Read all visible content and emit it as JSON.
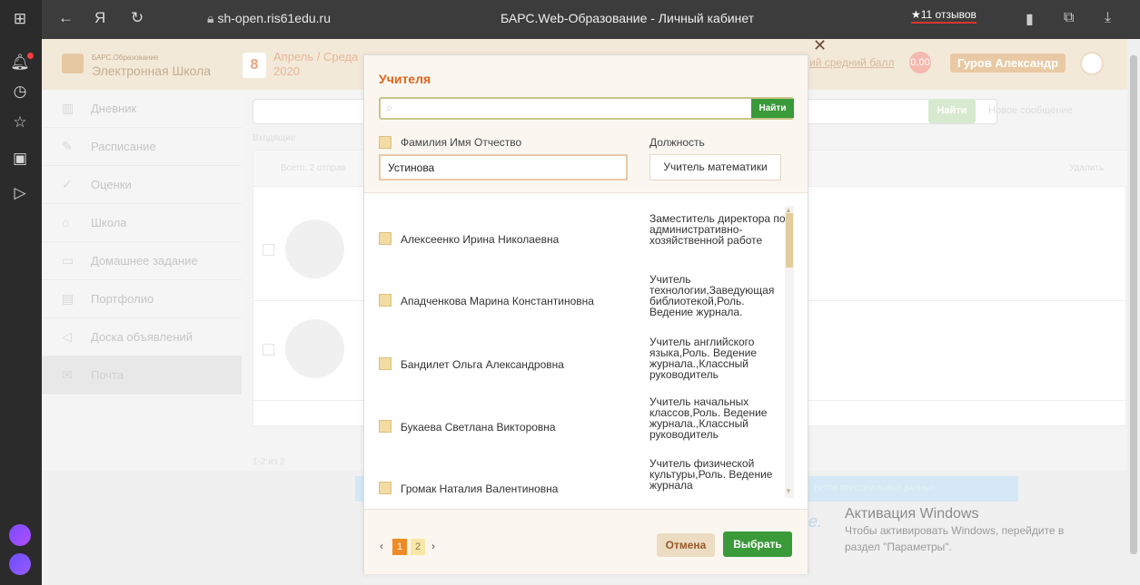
{
  "browser": {
    "url": "sh-open.ris61edu.ru",
    "page_title": "БАРС.Web-Образование - Личный кабинет",
    "reviews": "★11 отзывов"
  },
  "site": {
    "logo_small": "БАРС.Образование",
    "logo_big": "Электронная Школа",
    "date_day": "8",
    "date_text": "Апрель / Среда",
    "date_year": "2020",
    "avg_label": "ий средний балл",
    "avg_value": "0.00",
    "user_name": "Гуров Александр",
    "search_button": "Найти",
    "new_message": "Новое сообщение",
    "tabs": "Входящие",
    "total": "Всего: 2 отправ",
    "delete": "Удалить",
    "pager": "1-2 из 2",
    "banner_text": "ЕКТОВ ПЕРСОНАЛЬНЫХ ДАННЫХ",
    "nav": [
      {
        "label": "Дневник",
        "icon": "book-icon"
      },
      {
        "label": "Расписание",
        "icon": "pencil-icon"
      },
      {
        "label": "Оценки",
        "icon": "check-icon"
      },
      {
        "label": "Школа",
        "icon": "building-icon"
      },
      {
        "label": "Домашнее задание",
        "icon": "monitor-icon"
      },
      {
        "label": "Портфолио",
        "icon": "portfolio-icon"
      },
      {
        "label": "Доска объявлений",
        "icon": "megaphone-icon"
      },
      {
        "label": "Почта",
        "icon": "mail-icon"
      }
    ]
  },
  "modal": {
    "title": "Учителя",
    "search_placeholder": "",
    "search_button": "Найти",
    "fio_label": "Фамилия Имя Отчество",
    "position_label": "Должность",
    "fio_value": "Устинова",
    "position_value": "Учитель математики",
    "teachers": [
      {
        "name": "Алексеенко Ирина Николаевна",
        "position": "Заместитель директора по административно-хозяйственной работе"
      },
      {
        "name": "Ападченкова Марина Константиновна",
        "position": "Учитель технологии,Заведующая библиотекой,Роль. Ведение журнала."
      },
      {
        "name": "Бандилет Ольга Александровна",
        "position": "Учитель английского языка,Роль. Ведение журнала.,Классный руководитель"
      },
      {
        "name": "Букаева Светлана Викторовна",
        "position": "Учитель начальных классов,Роль. Ведение журнала.,Классный руководитель"
      },
      {
        "name": "Громак Наталия Валентиновна",
        "position": "Учитель физической культуры,Роль. Ведение журнала"
      }
    ],
    "pages": [
      "1",
      "2"
    ],
    "cancel": "Отмена",
    "select": "Выбрать"
  },
  "windows_watermark": {
    "line1": "Активация Windows",
    "line2": "Чтобы активировать Windows, перейдите в",
    "line3": "раздел \"Параметры\"."
  }
}
